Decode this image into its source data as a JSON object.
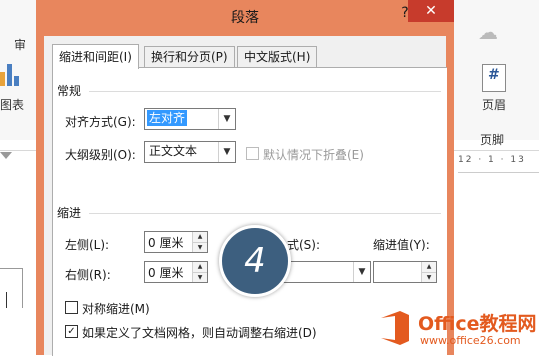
{
  "background": {
    "tab_left": "审",
    "chart_label": "图表",
    "header_label": "页眉",
    "footer_label": "页脚",
    "ruler_right": "12 · 1 · 13"
  },
  "dialog": {
    "title": "段落",
    "help": "?",
    "close": "✕",
    "tabs": [
      {
        "label": "缩进和间距(I)",
        "active": true
      },
      {
        "label": "换行和分页(P)",
        "active": false
      },
      {
        "label": "中文版式(H)",
        "active": false
      }
    ],
    "general": {
      "group_label": "常规",
      "alignment_label": "对齐方式(G):",
      "alignment_value": "左对齐",
      "outline_label": "大纲级别(O):",
      "outline_value": "正文文本",
      "collapse_label": "默认情况下折叠(E)"
    },
    "indent": {
      "group_label": "缩进",
      "left_label": "左侧(L):",
      "left_value": "0 厘米",
      "right_label": "右侧(R):",
      "right_value": "0 厘米",
      "special_label": "式(S):",
      "special_value": "",
      "by_label": "缩进值(Y):",
      "by_value": "",
      "mirror_label": "对称缩进(M)",
      "mirror_checked": false,
      "grid_label": "如果定义了文档网格，则自动调整右缩进(D)",
      "grid_checked": true
    },
    "step_badge": "4"
  },
  "watermark": {
    "brand": "Office教程网",
    "url": "www.office26.com"
  },
  "colors": {
    "dialog_frame": "#e8865d",
    "close_button": "#c73b2c",
    "selection": "#3399ff",
    "badge": "#3d5f7f",
    "brand": "#e35a1f"
  }
}
